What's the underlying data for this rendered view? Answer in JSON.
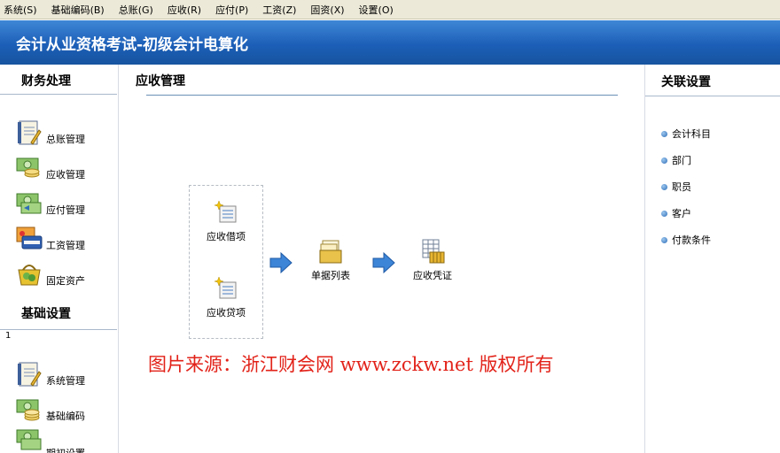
{
  "menu": [
    {
      "label": "系统(S)"
    },
    {
      "label": "基础编码(B)"
    },
    {
      "label": "总账(G)"
    },
    {
      "label": "应收(R)"
    },
    {
      "label": "应付(P)"
    },
    {
      "label": "工资(Z)"
    },
    {
      "label": "固资(X)"
    },
    {
      "label": "设置(O)"
    }
  ],
  "app": {
    "title": "会计从业资格考试-初级会计电算化"
  },
  "left": {
    "finance": {
      "title": "财务处理",
      "items": [
        {
          "label": "总账管理",
          "icon": "ledger-book-icon"
        },
        {
          "label": "应收管理",
          "icon": "money-receive-icon"
        },
        {
          "label": "应付管理",
          "icon": "money-pay-icon"
        },
        {
          "label": "工资管理",
          "icon": "card-payroll-icon"
        },
        {
          "label": "固定资产",
          "icon": "basket-assets-icon"
        }
      ]
    },
    "basic": {
      "title": "基础设置",
      "marker": "1",
      "items": [
        {
          "label": "系统管理",
          "icon": "system-book-icon"
        },
        {
          "label": "基础编码",
          "icon": "coins-code-icon"
        },
        {
          "label": "期初设置",
          "icon": "money-init-icon"
        }
      ]
    }
  },
  "center": {
    "title": "应收管理",
    "flow": [
      {
        "label": "应收借项",
        "icon": "debit-doc-icon"
      },
      {
        "label": "应收贷项",
        "icon": "credit-doc-icon"
      },
      {
        "label": "单据列表",
        "icon": "document-list-icon"
      },
      {
        "label": "应收凭证",
        "icon": "voucher-icon"
      }
    ],
    "watermark": "图片来源：浙江财会网 www.zckw.net 版权所有"
  },
  "right": {
    "title": "关联设置",
    "links": [
      {
        "label": "会计科目"
      },
      {
        "label": "部门"
      },
      {
        "label": "职员"
      },
      {
        "label": "客户"
      },
      {
        "label": "付款条件"
      }
    ]
  },
  "colors": {
    "title_bar": "#1c5fb8",
    "watermark": "#e2231a",
    "menu_bg": "#ece9d8"
  }
}
